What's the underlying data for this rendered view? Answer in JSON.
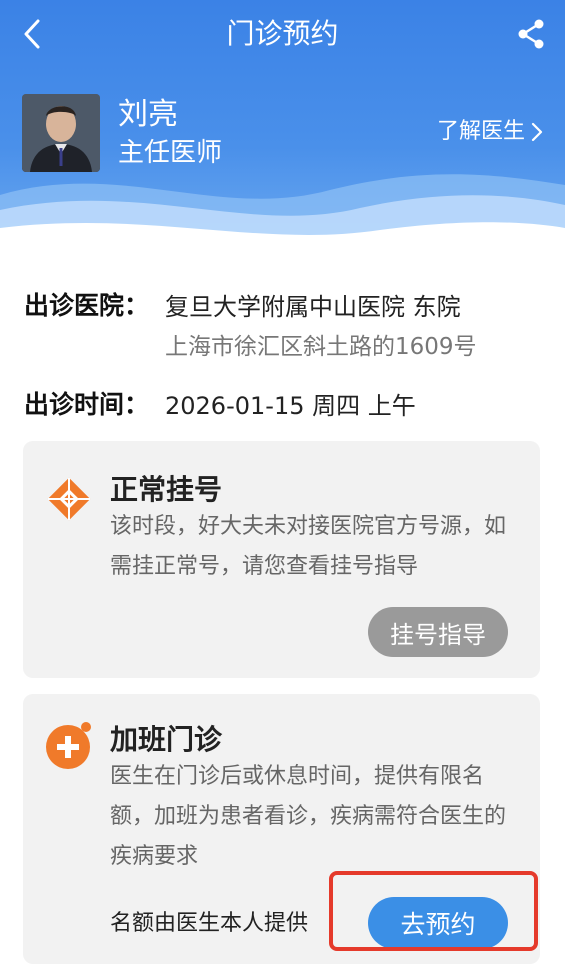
{
  "nav": {
    "title": "门诊预约",
    "back_icon": "chevron-left-icon",
    "share_icon": "share-icon"
  },
  "doctor": {
    "name": "刘亮",
    "title": "主任医师",
    "about_label": "了解医生"
  },
  "info": {
    "hospital_label": "出诊医院：",
    "hospital_name": "复旦大学附属中山医院 东院",
    "hospital_address": "上海市徐汇区斜土路的1609号",
    "time_label": "出诊时间：",
    "time_value": "2026-01-15 周四 上午"
  },
  "normal_registration": {
    "title": "正常挂号",
    "description": "该时段，好大夫未对接医院官方号源，如需挂正常号，请您查看挂号指导",
    "button_label": "挂号指导",
    "icon_color": "#f07a2a"
  },
  "extra_clinic": {
    "title": "加班门诊",
    "description": "医生在门诊后或休息时间，提供有限名额，加班为患者看诊，疾病需符合医生的疾病要求",
    "quota_text": "名额由医生本人提供",
    "button_label": "去预约",
    "icon_color": "#f07a2a"
  },
  "colors": {
    "header_blue": "#3b82e6",
    "button_blue": "#3b8fe6",
    "highlight_red": "#e53a2b"
  }
}
